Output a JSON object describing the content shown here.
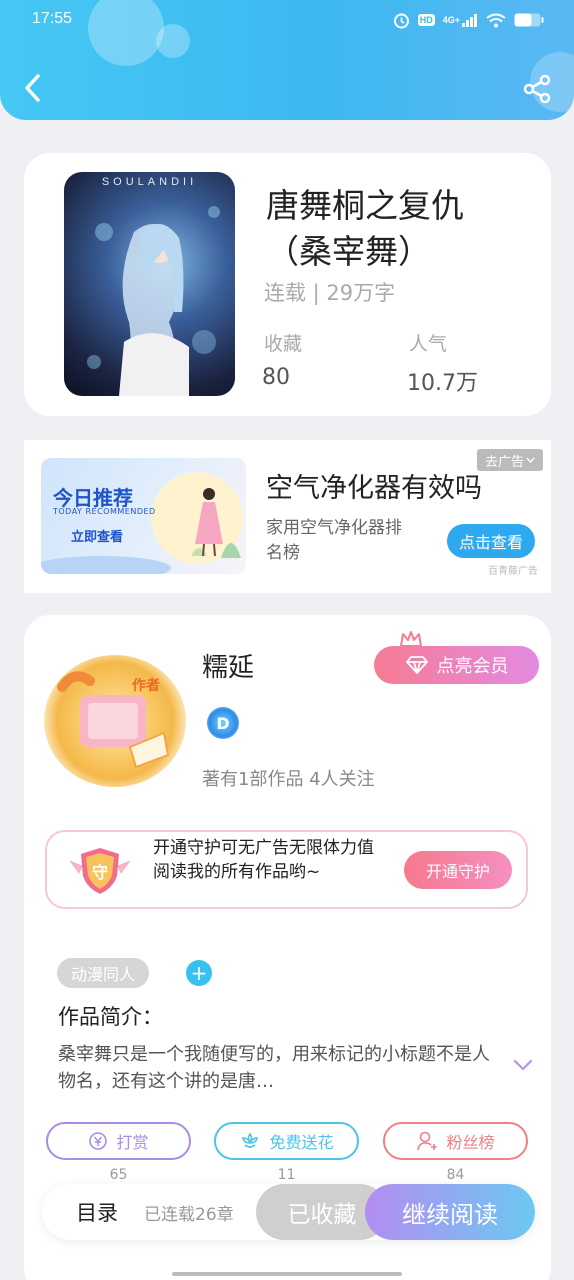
{
  "status_bar": {
    "time": "17:55",
    "network": "4G+",
    "hd": "HD"
  },
  "book": {
    "cover_title": "SOULANDII",
    "title": "唐舞桐之复仇（桑宰舞）",
    "status": "连载 | 29万字",
    "favorites_label": "收藏",
    "favorites_value": "80",
    "popularity_label": "人气",
    "popularity_value": "10.7万"
  },
  "ad": {
    "close_label": "去广告",
    "banner_title": "今日推荐",
    "banner_subtitle": "TODAY RECOMMENDED",
    "banner_button": "立即查看",
    "title": "空气净化器有效吗",
    "description": "家用空气净化器排名榜",
    "cta_label": "点击查看",
    "source": "百青藤广告"
  },
  "author": {
    "badge": "作者",
    "name": "糯延",
    "member_button": "点亮会员",
    "vip_letter": "D",
    "meta": "著有1部作品 4人关注"
  },
  "guard": {
    "shield_char": "守",
    "text": "开通守护可无广告无限体力值阅读我的所有作品哟~",
    "button": "开通守护"
  },
  "intro": {
    "tag": "动漫同人",
    "add_symbol": "+",
    "title": "作品简介：",
    "body": "桑宰舞只是一个我随便写的，用来标记的小标题不是人物名，还有这个讲的是唐…"
  },
  "actions": [
    {
      "label": "打赏",
      "count": "65",
      "color": "#a98bea"
    },
    {
      "label": "免费送花",
      "count": "11",
      "color": "#4ec3e6"
    },
    {
      "label": "粉丝榜",
      "count": "84",
      "color": "#f07f86"
    }
  ],
  "bottom_bar": {
    "toc": "目录",
    "serial": "已连载26章",
    "collected": "已收藏",
    "read": "继续阅读"
  }
}
